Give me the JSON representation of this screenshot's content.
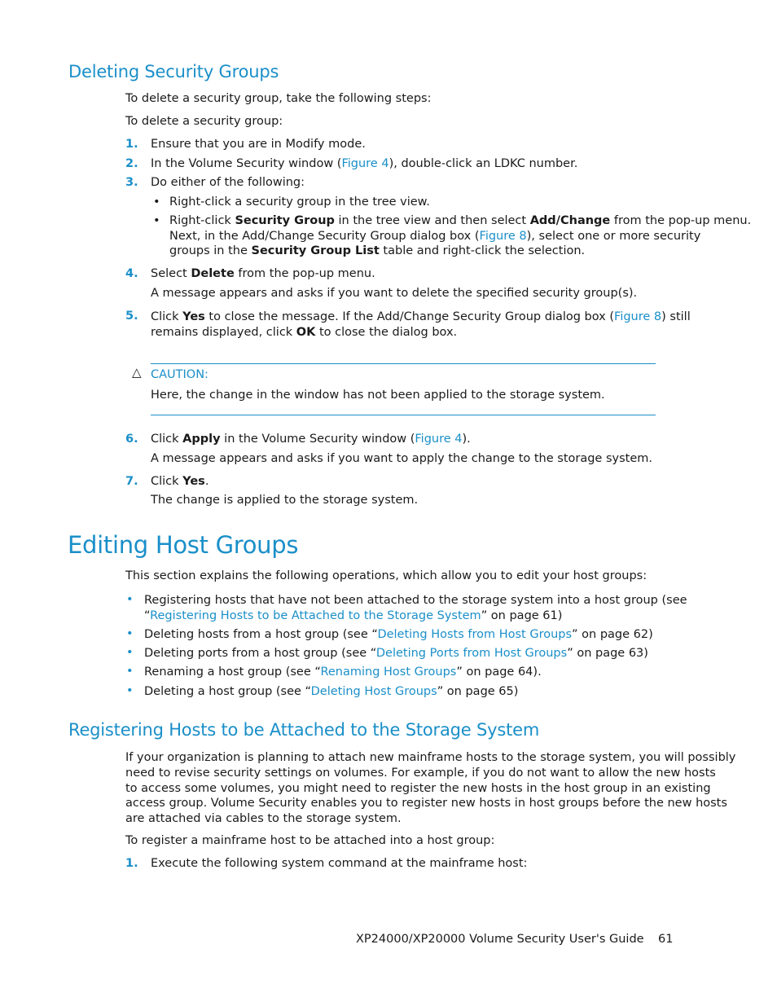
{
  "section1": {
    "title": "Deleting Security Groups",
    "intro1": "To delete a security group, take the following steps:",
    "intro2": "To delete a security group:",
    "steps": [
      {
        "num": "1.",
        "text": "Ensure that you are in Modify mode."
      },
      {
        "num": "2.",
        "pre": "In the Volume Security window (",
        "link": "Figure 4",
        "post": "), double-click an LDKC number."
      },
      {
        "num": "3.",
        "text": "Do either of the following:"
      },
      {
        "num": "4.",
        "pre": "Select ",
        "bold": "Delete",
        "post": " from the pop-up menu.",
        "note": "A message appears and asks if you want to delete the specified security group(s)."
      },
      {
        "num": "5.",
        "l1_pre": "Click ",
        "l1_bold": "Yes",
        "l1_mid": " to close the message. If the Add/Change Security Group dialog box (",
        "l1_link": "Figure 8",
        "l1_post": ") still",
        "l2_pre": "remains displayed, click ",
        "l2_bold": "OK",
        "l2_post": " to close the dialog box."
      },
      {
        "num": "6.",
        "pre": "Click ",
        "bold": "Apply",
        "mid": " in the Volume Security window (",
        "link": "Figure 4",
        "post": ").",
        "note": "A message appears and asks if you want to apply the change to the storage system."
      },
      {
        "num": "7.",
        "pre": "Click ",
        "bold": "Yes",
        "post": ".",
        "note": "The change is applied to the storage system."
      }
    ],
    "substeps": {
      "a": "Right-click a security group in the tree view.",
      "b": {
        "l1_pre": "Right-click ",
        "l1_bold1": "Security Group",
        "l1_mid": " in the tree view and then select ",
        "l1_bold2": "Add/Change",
        "l1_post": " from the pop-up menu.",
        "l2_pre": "Next, in the Add/Change Security Group dialog box (",
        "l2_link": "Figure 8",
        "l2_post": "), select one or more security",
        "l3_pre": "groups in the ",
        "l3_bold": "Security Group List",
        "l3_post": " table and right-click the selection."
      }
    },
    "caution": {
      "icon": "warning-triangle-icon",
      "label": "CAUTION:",
      "text": "Here, the change in the window has not been applied to the storage system."
    }
  },
  "section2": {
    "title": "Editing Host Groups",
    "intro": "This section explains the following operations, which allow you to edit your host groups:",
    "items": [
      {
        "l1": "Registering hosts that have not been attached to the storage system into a host group (see",
        "pre": "“",
        "link": "Registering Hosts to be Attached to the Storage System",
        "post": "” on page 61)"
      },
      {
        "pre": "Deleting hosts from a host group (see “",
        "link": "Deleting Hosts from Host Groups",
        "post": "” on page 62)"
      },
      {
        "pre": "Deleting ports from a host group (see “",
        "link": "Deleting Ports from Host Groups",
        "post": "” on page 63)"
      },
      {
        "pre": "Renaming a host group (see “",
        "link": "Renaming Host Groups",
        "post": "” on page 64)."
      },
      {
        "pre": "Deleting a host group (see “",
        "link": "Deleting Host Groups",
        "post": "” on page 65)"
      }
    ]
  },
  "section3": {
    "title": "Registering Hosts to be Attached to the Storage System",
    "para_lines": [
      "If your organization is planning to attach new mainframe hosts to the storage system, you will possibly",
      "need to revise security settings on volumes. For example, if you do not want to allow the new hosts",
      "to access some volumes, you might need to register the new hosts in the host group in an existing",
      "access group. Volume Security enables you to register new hosts in host groups before the new hosts",
      "are attached via cables to the storage system."
    ],
    "intro2": "To register a mainframe host to be attached into a host group:",
    "steps": [
      {
        "num": "1.",
        "text": "Execute the following system command at the mainframe host:"
      }
    ]
  },
  "footer": {
    "guide_title": "XP24000/XP20000 Volume Security User's Guide",
    "page_number": "61"
  }
}
